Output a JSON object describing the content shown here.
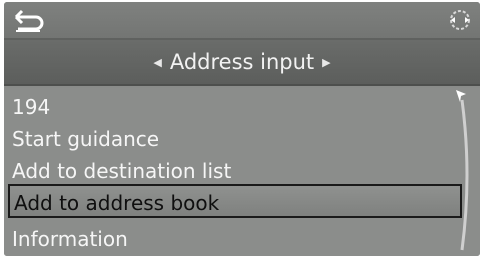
{
  "header": {
    "title": "Address input",
    "back_icon": "back-arrow-icon",
    "controller_icon": "controller-knob-icon"
  },
  "menu": {
    "items": [
      {
        "label": "194",
        "selected": false
      },
      {
        "label": "Start guidance",
        "selected": false
      },
      {
        "label": "Add to destination list",
        "selected": false
      },
      {
        "label": "Add to address book",
        "selected": true
      },
      {
        "label": "Information",
        "selected": false
      }
    ]
  },
  "colors": {
    "background": "#8a8c8a",
    "title_bar": "#5f615f",
    "text": "#f6f6f6",
    "selection_border": "#1a1a1a"
  }
}
